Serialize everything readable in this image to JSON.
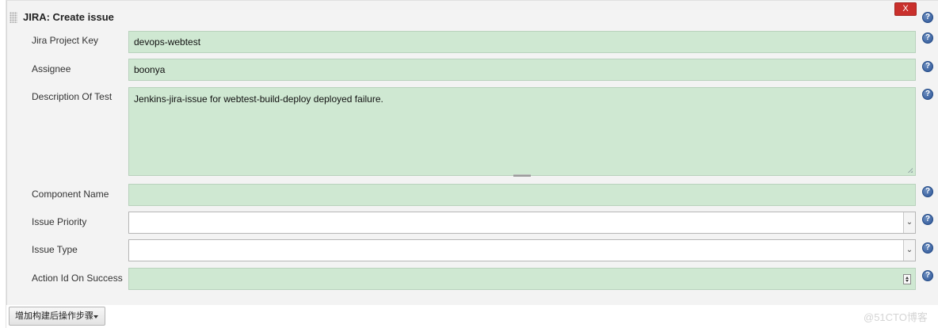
{
  "section": {
    "title": "JIRA: Create issue",
    "delete_label": "X",
    "help_label": "?"
  },
  "fields": {
    "project_key": {
      "label": "Jira Project Key",
      "value": "devops-webtest"
    },
    "assignee": {
      "label": "Assignee",
      "value": "boonya"
    },
    "description": {
      "label": "Description Of Test",
      "value": "Jenkins-jira-issue for webtest-build-deploy  deployed failure."
    },
    "component": {
      "label": "Component Name",
      "value": ""
    },
    "priority": {
      "label": "Issue Priority",
      "value": ""
    },
    "issue_type": {
      "label": "Issue Type",
      "value": ""
    },
    "action_id": {
      "label": "Action Id On Success",
      "value": ""
    }
  },
  "footer": {
    "add_step_label": "增加构建后操作步骤",
    "watermark": "@51CTO博客"
  },
  "colors": {
    "field_bg": "#cfe8d2",
    "delete_bg": "#c9302c",
    "help_bg": "#2d5597"
  },
  "icons": {
    "help": "help-circle-icon",
    "dropdown": "chevron-down-icon",
    "spinner": "number-spinner-icon",
    "grip": "drag-handle-icon"
  }
}
